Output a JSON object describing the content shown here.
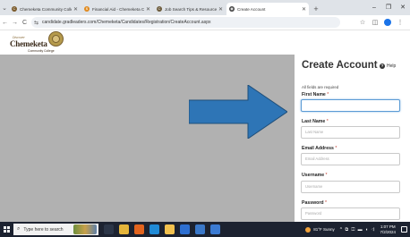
{
  "browser": {
    "tabs": [
      {
        "title": "Chemeketa Community Colleg",
        "fav_color": "#7a5a2a",
        "fav_glyph": "C",
        "active": false
      },
      {
        "title": "Financial Aid - Chemeketa Co",
        "fav_color": "#e08a1e",
        "fav_glyph": "$",
        "active": false
      },
      {
        "title": "Job Search Tips & Resources",
        "fav_color": "#6b5a3a",
        "fav_glyph": "C",
        "active": false
      },
      {
        "title": "Create Account",
        "fav_color": "#444444",
        "fav_glyph": "◉",
        "active": true
      }
    ],
    "new_tab": "+",
    "window_controls": {
      "minimize": "–",
      "maximize": "❐",
      "close": "✕"
    },
    "url": "candidate.gradleaders.com/Chemeketa/Candidates/Registration/CreateAccount.aspx",
    "nav_icons": {
      "back": "←",
      "forward": "→",
      "reload": "C",
      "site_info": "⇆",
      "bookmark": "☆",
      "sidepanel": "◫",
      "menu": "⋮"
    }
  },
  "site": {
    "logo_small": "Discover",
    "logo_main": "Chemeketa",
    "logo_sub": "Community College"
  },
  "form": {
    "title": "Create Account",
    "help_label": "Help",
    "help_icon": "?",
    "required_note": "All fields are required",
    "fields": [
      {
        "label": "First Name",
        "placeholder": ""
      },
      {
        "label": "Last Name",
        "placeholder": "Last Name"
      },
      {
        "label": "Email Address",
        "placeholder": "Email Address"
      },
      {
        "label": "Username",
        "placeholder": "Username"
      },
      {
        "label": "Password",
        "placeholder": "Password"
      }
    ],
    "required_star": "*"
  },
  "colors": {
    "arrow": "#2e75b6",
    "gray_overlay": "#b1b1b1",
    "taskbar": "#1c2230"
  },
  "taskbar": {
    "search_placeholder": "Type here to search",
    "search_icon": "⌕",
    "weather": "81°F Sunny",
    "tray_icons": "^ ⧉ ◫ ▬ ◖ ◁",
    "time": "1:07 PM",
    "date": "7/2/2024",
    "app_icons": [
      {
        "name": "task-view",
        "color": "#2b3547"
      },
      {
        "name": "chrome",
        "color": "#e5b53a"
      },
      {
        "name": "firefox",
        "color": "#e2641e"
      },
      {
        "name": "edge",
        "color": "#1f8ad6"
      },
      {
        "name": "file-explorer",
        "color": "#f2c14e"
      },
      {
        "name": "mail",
        "color": "#2d6fd1"
      },
      {
        "name": "store",
        "color": "#3a78c9"
      },
      {
        "name": "app",
        "color": "#3b7bd3"
      }
    ]
  }
}
